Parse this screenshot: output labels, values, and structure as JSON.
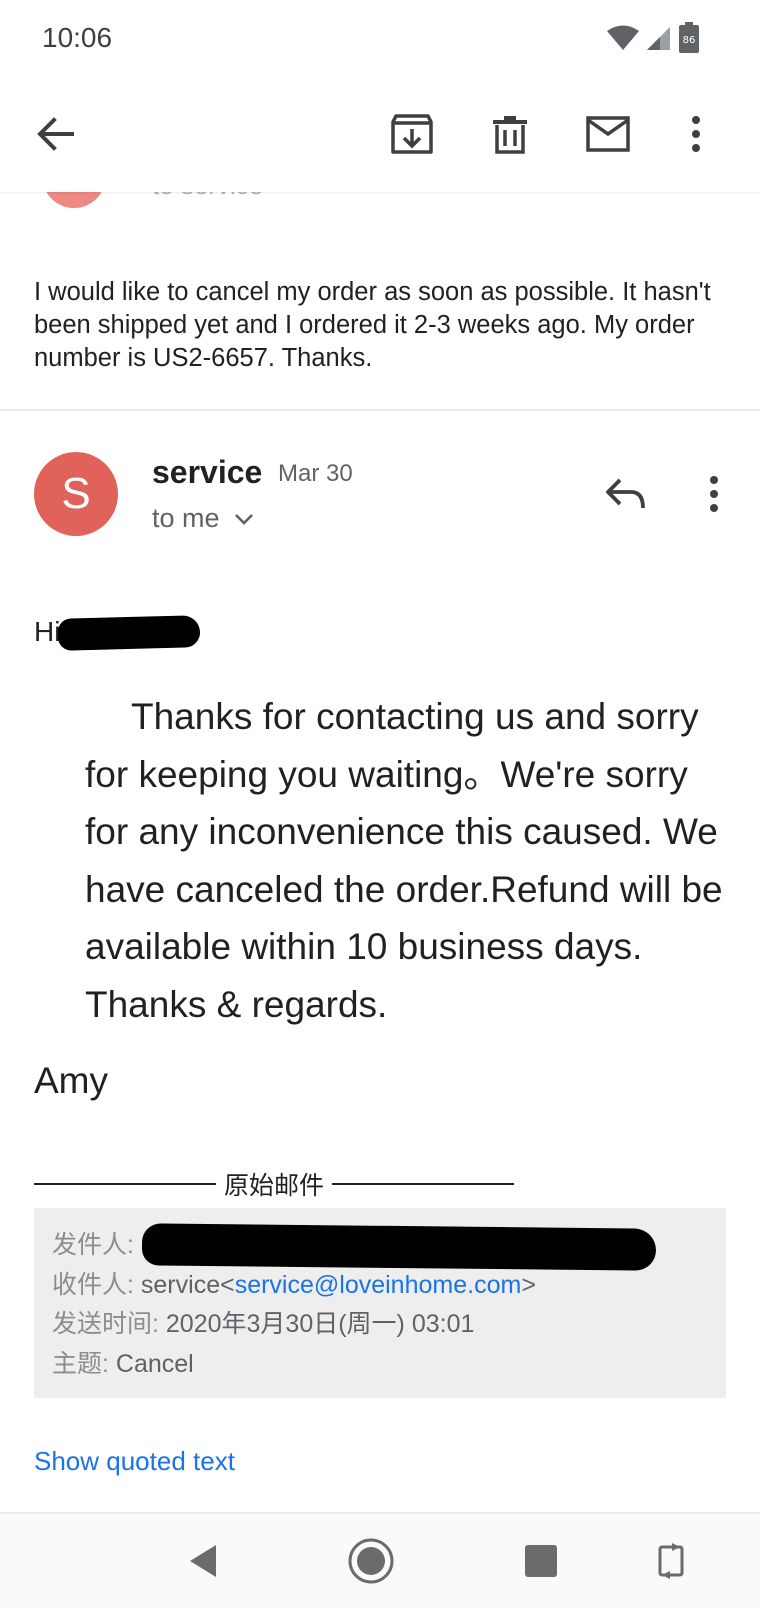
{
  "status_bar": {
    "time": "10:06",
    "battery": "86"
  },
  "previous_message": {
    "to_label": "to service",
    "body": "I would like to cancel my order as soon as possible. It hasn't been shipped yet and I ordered it 2-3 weeks ago. My order number is US2-6657. Thanks."
  },
  "message": {
    "avatar_letter": "S",
    "sender": "service",
    "date": "Mar 30",
    "to": "to me",
    "greeting": "Hi",
    "body": "Thanks for contacting us and sorry for keeping you waiting。We're sorry for any inconvenience this caused. We have canceled the order.Refund will be available within 10 business days. Thanks & regards.",
    "signature": "Amy"
  },
  "original_mail": {
    "header_label": "原始邮件",
    "from_key": "发件人:",
    "to_key": "收件人:",
    "to_name": "service<",
    "to_email": "service@loveinhome.com",
    "to_close": ">",
    "sent_key": "发送时间:",
    "sent_value": "2020年3月30日(周一)  03:01",
    "subject_key": "主题:",
    "subject_value": "Cancel"
  },
  "show_quoted_text": "Show quoted text",
  "colors": {
    "avatar": "#e0625a",
    "link": "#1a73e8",
    "quoted_bg": "#eeeeee"
  },
  "icons": [
    "back-arrow-icon",
    "archive-icon",
    "trash-icon",
    "mail-icon",
    "more-vert-icon",
    "reply-icon",
    "chevron-down-icon",
    "wifi-icon",
    "signal-icon",
    "battery-icon",
    "nav-back-icon",
    "nav-home-icon",
    "nav-recents-icon",
    "rotate-icon"
  ]
}
